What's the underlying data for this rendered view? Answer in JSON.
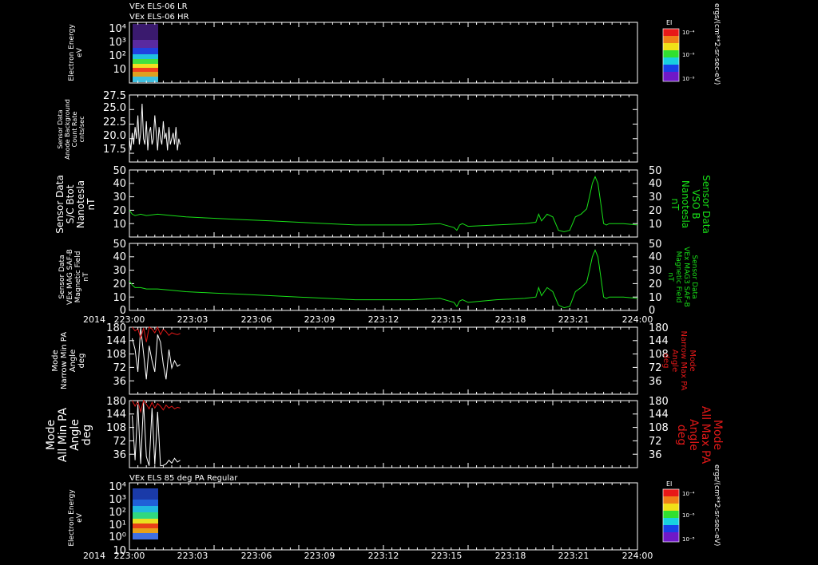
{
  "colors": {
    "background": "#000000",
    "axis": "#ffffff",
    "trace_white": "#ffffff",
    "trace_green": "#18e018",
    "trace_red": "#e01818"
  },
  "top_titles": [
    "VEx ELS-06 LR",
    "VEx ELS-06 HR"
  ],
  "time_axis": {
    "year": "2014",
    "ticks": [
      "223:00",
      "223:03",
      "223:06",
      "223:09",
      "223:12",
      "223:15",
      "223:18",
      "223:21",
      "224:00"
    ]
  },
  "chart_data": [
    {
      "id": "p1",
      "type": "heatmap",
      "ylabel": [
        "Electron Energy",
        "eV"
      ],
      "yticks": [
        "10",
        "10²",
        "10³",
        "10⁴"
      ],
      "colorbar": {
        "title": "EI",
        "ticks": [
          "10⁻⁴",
          "10⁻⁶",
          "10⁻⁸"
        ]
      },
      "right_unit": "ergs/(cm**2-sr-sec-eV)"
    },
    {
      "id": "p2",
      "type": "line",
      "ylabel": [
        "Sensor Data",
        "Anode Background",
        "Count Rate",
        "cnts/sec"
      ],
      "ylim": [
        16,
        27.5
      ],
      "yticks": [
        "17.5",
        "20.0",
        "22.5",
        "25.0",
        "27.5"
      ],
      "series": [
        {
          "color": "white",
          "x": [
            0,
            0.5,
            1,
            1.5,
            2,
            2.5,
            3,
            3.5,
            4,
            4.5,
            5,
            5.5,
            6,
            6.5,
            7,
            7.5,
            8,
            8.5,
            9,
            9.5,
            10,
            10.5,
            11,
            11.5,
            12,
            12.5,
            13,
            13.5,
            14,
            14.5,
            15,
            15.5,
            16,
            16.5,
            17,
            17.5,
            18
          ],
          "y": [
            20,
            18,
            21,
            19,
            22,
            20,
            24,
            19,
            21,
            26,
            20,
            19,
            23,
            18,
            21,
            22,
            19,
            20,
            24,
            21,
            18,
            22,
            20,
            19,
            23,
            20,
            21,
            18,
            22,
            19,
            20,
            21,
            19,
            22,
            18,
            20,
            19
          ]
        }
      ]
    },
    {
      "id": "p3",
      "type": "line",
      "ylabel": [
        "Sensor Data",
        "S/C Btot",
        "Nanotesla",
        "nT"
      ],
      "right_label": [
        "Sensor Data",
        "VSO B",
        "Nanotesla",
        "nT"
      ],
      "ylim": [
        0,
        50
      ],
      "yticks": [
        "10",
        "20",
        "30",
        "40",
        "50"
      ],
      "series": [
        {
          "color": "green",
          "x": [
            0,
            1,
            2,
            4,
            6,
            10,
            15,
            20,
            30,
            40,
            50,
            60,
            70,
            80,
            90,
            100,
            110,
            115,
            116,
            117,
            118,
            119,
            120,
            130,
            140,
            144,
            145,
            146,
            148,
            150,
            152,
            154,
            156,
            158,
            160,
            162,
            163,
            164,
            165,
            166,
            167,
            168,
            169,
            170,
            175,
            180
          ],
          "y": [
            20,
            17,
            16,
            17,
            16,
            17,
            16,
            15,
            14,
            13,
            12,
            11,
            10,
            9,
            9,
            9,
            10,
            7,
            5,
            9,
            10,
            9,
            8,
            9,
            10,
            11,
            17,
            12,
            17,
            15,
            5,
            4,
            5,
            15,
            17,
            21,
            30,
            40,
            45,
            40,
            25,
            10,
            9,
            10,
            10,
            9
          ]
        }
      ]
    },
    {
      "id": "p4",
      "type": "line",
      "ylabel": [
        "Sensor Data",
        "VEx MAG SAF-B",
        "Magnetic Field",
        "nT"
      ],
      "right_label": [
        "Sensor Data",
        "VEx MAG3 SAF-B",
        "Magnetic Field",
        "nT"
      ],
      "ylim": [
        0,
        50
      ],
      "yticks": [
        "0",
        "10",
        "20",
        "30",
        "40",
        "50"
      ],
      "series": [
        {
          "color": "green",
          "x": [
            0,
            1,
            2,
            4,
            6,
            10,
            15,
            20,
            30,
            40,
            50,
            60,
            70,
            80,
            90,
            100,
            110,
            115,
            116,
            117,
            118,
            119,
            120,
            130,
            140,
            144,
            145,
            146,
            148,
            150,
            152,
            154,
            156,
            158,
            160,
            162,
            163,
            164,
            165,
            166,
            167,
            168,
            169,
            170,
            175,
            180
          ],
          "y": [
            22,
            19,
            17,
            17,
            16,
            16,
            15,
            14,
            13,
            12,
            11,
            10,
            9,
            8,
            8,
            8,
            9,
            6,
            3,
            7,
            8,
            7,
            6,
            8,
            9,
            10,
            17,
            11,
            17,
            14,
            4,
            2,
            3,
            14,
            17,
            21,
            30,
            40,
            45,
            40,
            25,
            10,
            9,
            10,
            10,
            9
          ]
        }
      ]
    },
    {
      "id": "p5",
      "type": "line",
      "ylabel": [
        "Mode",
        "Narrow Min PA",
        "Angle",
        "deg"
      ],
      "right_label": [
        "Mode",
        "Narrow Max PA",
        "Angle",
        "deg"
      ],
      "ylim": [
        0,
        180
      ],
      "yticks": [
        "36",
        "72",
        "108",
        "144",
        "180"
      ],
      "series": [
        {
          "color": "white",
          "x": [
            1,
            2,
            3,
            4,
            5,
            6,
            7,
            8,
            9,
            10,
            11,
            12,
            13,
            14,
            15,
            16,
            17,
            18
          ],
          "y": [
            150,
            120,
            60,
            180,
            110,
            40,
            130,
            90,
            60,
            160,
            140,
            80,
            40,
            120,
            70,
            90,
            75,
            80
          ]
        },
        {
          "color": "red",
          "x": [
            1,
            2,
            3,
            4,
            5,
            6,
            7,
            8,
            9,
            10,
            11,
            12,
            13,
            14,
            15,
            16,
            17,
            18
          ],
          "y": [
            180,
            170,
            176,
            150,
            178,
            140,
            180,
            175,
            165,
            180,
            160,
            175,
            168,
            158,
            165,
            162,
            160,
            163
          ]
        }
      ]
    },
    {
      "id": "p6",
      "type": "line",
      "ylabel": [
        "Mode",
        "All Min PA",
        "Angle",
        "deg"
      ],
      "right_label": [
        "Mode",
        "All Max PA",
        "Angle",
        "deg"
      ],
      "ylim": [
        0,
        180
      ],
      "yticks": [
        "36",
        "72",
        "108",
        "144",
        "180"
      ],
      "series": [
        {
          "color": "white",
          "x": [
            1,
            2,
            3,
            4,
            5,
            6,
            7,
            8,
            9,
            10,
            11,
            12,
            13,
            14,
            15,
            16,
            17,
            18
          ],
          "y": [
            140,
            20,
            170,
            10,
            175,
            30,
            5,
            160,
            8,
            150,
            5,
            6,
            10,
            20,
            12,
            25,
            15,
            20
          ]
        },
        {
          "color": "red",
          "x": [
            1,
            2,
            3,
            4,
            5,
            6,
            7,
            8,
            9,
            10,
            11,
            12,
            13,
            14,
            15,
            16,
            17,
            18
          ],
          "y": [
            180,
            165,
            178,
            150,
            180,
            170,
            158,
            175,
            160,
            172,
            165,
            155,
            168,
            160,
            165,
            158,
            162,
            160
          ]
        }
      ]
    },
    {
      "id": "p7",
      "type": "heatmap",
      "title": "VEx ELS 85 deg PA Regular",
      "ylabel": [
        "Electron Energy",
        "eV"
      ],
      "yticks": [
        "10",
        "10⁰",
        "10¹",
        "10²",
        "10³",
        "10⁴"
      ],
      "colorbar": {
        "title": "EI",
        "ticks": [
          "10⁻⁴",
          "10⁻⁶",
          "10⁻⁸"
        ]
      },
      "right_unit": "ergs/(cm**2-sr-sec-eV)"
    }
  ]
}
